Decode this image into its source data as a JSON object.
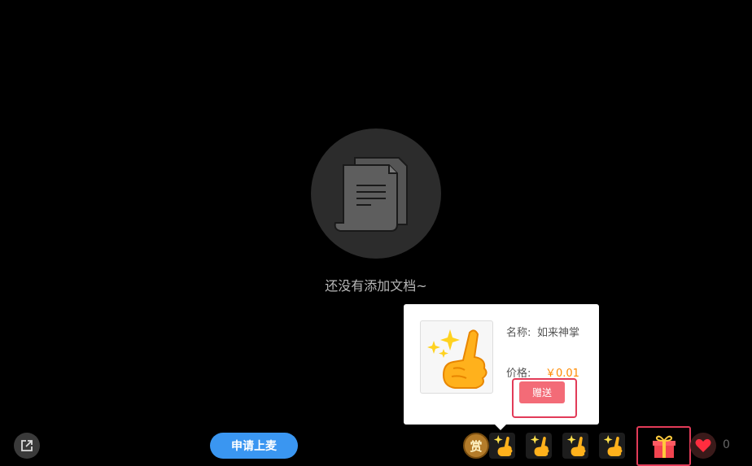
{
  "empty_state": {
    "message": "还没有添加文档~",
    "icon": "document-stack-icon"
  },
  "gift_popup": {
    "name_label": "名称:",
    "name_value": "如来神掌",
    "price_label": "价格:",
    "price_value": "￥0.01",
    "send_label": "赠送",
    "image_icon": "thumbs-up-sparkle-icon"
  },
  "toolbar": {
    "share_icon": "external-link-icon",
    "apply_label": "申请上麦",
    "reward_label": "赏",
    "gifts": [
      {
        "icon": "thumbs-up-sparkle-icon"
      },
      {
        "icon": "thumbs-up-sparkle-icon"
      },
      {
        "icon": "thumbs-up-sparkle-icon"
      },
      {
        "icon": "thumbs-up-sparkle-icon"
      }
    ],
    "gift_box_icon": "gift-box-icon",
    "like_icon": "heart-icon",
    "like_count": "0"
  },
  "colors": {
    "background": "#000000",
    "apply_button": "#3a96f1",
    "send_button": "#f36b77",
    "highlight_outline": "#e23b58",
    "price": "#ff8a00"
  }
}
